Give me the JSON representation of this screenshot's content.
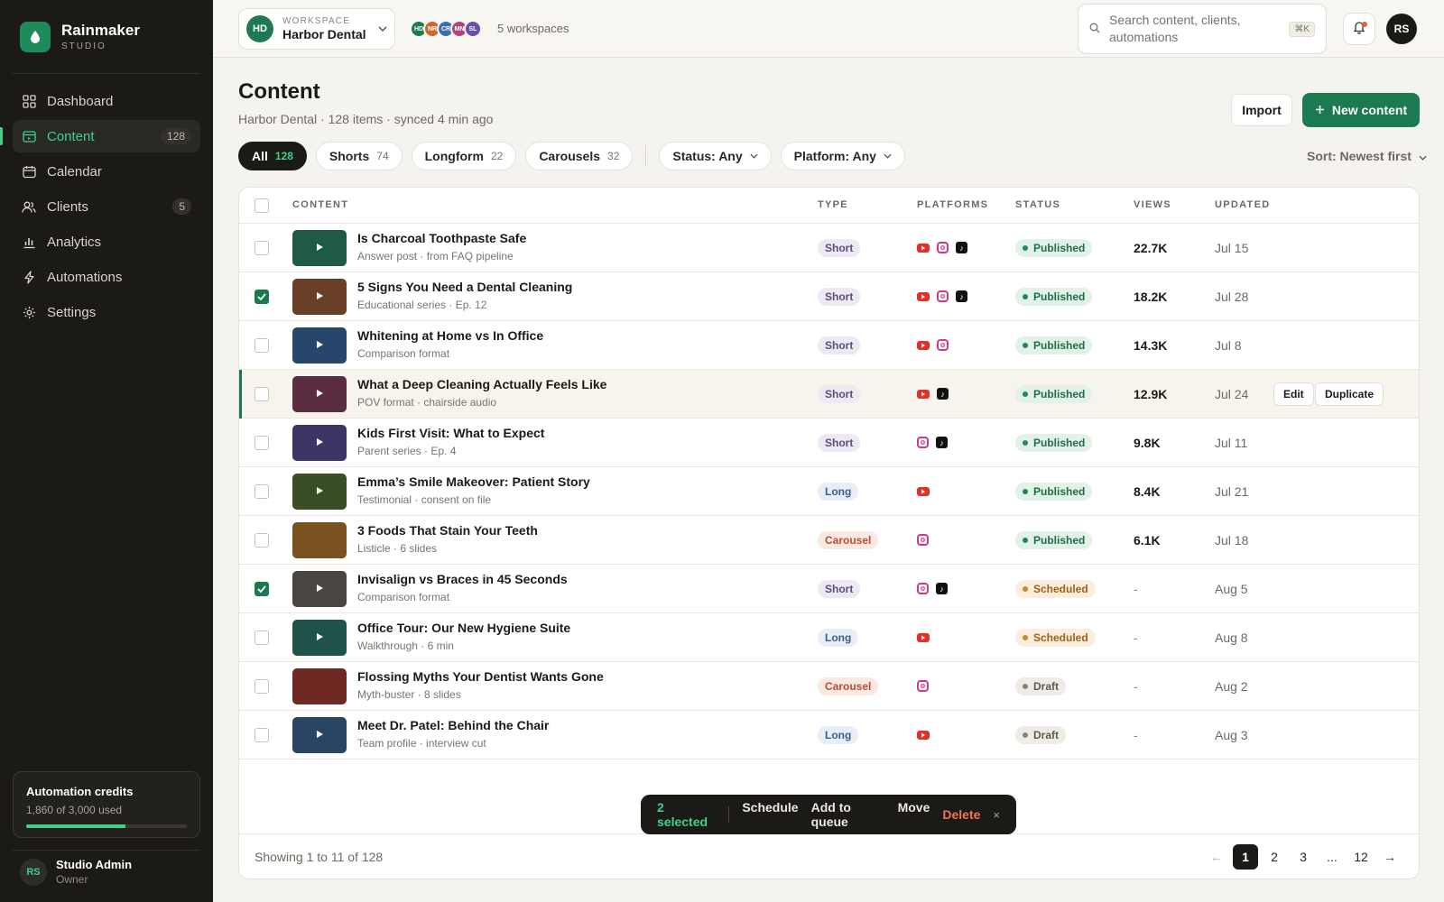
{
  "brand": {
    "name": "Rainmaker",
    "sub": "STUDIO"
  },
  "nav": [
    {
      "label": "Dashboard",
      "icon": "grid-icon",
      "count": ""
    },
    {
      "label": "Content",
      "icon": "content-icon",
      "count": "128",
      "active": true
    },
    {
      "label": "Calendar",
      "icon": "calendar-icon",
      "count": ""
    },
    {
      "label": "Clients",
      "icon": "users-icon",
      "count": "5"
    },
    {
      "label": "Analytics",
      "icon": "bar-chart-icon",
      "count": ""
    },
    {
      "label": "Automations",
      "icon": "bolt-icon",
      "count": ""
    },
    {
      "label": "Settings",
      "icon": "gear-icon",
      "count": ""
    }
  ],
  "credits": {
    "title": "Automation credits",
    "sub": "1,860 of 3,000 used",
    "used_fraction": 0.62
  },
  "user": {
    "initials": "RS",
    "name": "Studio Admin",
    "role": "Owner"
  },
  "workspace": {
    "label": "WORKSPACE",
    "name": "Harbor Dental",
    "initials": "HD",
    "others": [
      {
        "initials": "HD",
        "color": "#1f7a52"
      },
      {
        "initials": "NR",
        "color": "#c46a2d"
      },
      {
        "initials": "CR",
        "color": "#3b6fb0"
      },
      {
        "initials": "MN",
        "color": "#b0457a"
      },
      {
        "initials": "SL",
        "color": "#6a4fa3"
      }
    ],
    "count_label": "5 workspaces"
  },
  "search": {
    "placeholder": "Search content, clients, automations",
    "shortcut": "⌘K"
  },
  "top_avatar": "RS",
  "header": {
    "title": "Content",
    "subtitle": "Harbor Dental · 128 items · synced 4 min ago",
    "import_label": "Import",
    "new_label": "New content"
  },
  "filters": {
    "tabs": [
      {
        "label": "All",
        "count": "128",
        "active": true
      },
      {
        "label": "Shorts",
        "count": "74"
      },
      {
        "label": "Longform",
        "count": "22"
      },
      {
        "label": "Carousels",
        "count": "32"
      }
    ],
    "status": "Status: Any",
    "platform": "Platform: Any",
    "sort": "Sort: Newest first"
  },
  "table": {
    "columns": {
      "content": "CONTENT",
      "type": "TYPE",
      "platforms": "PLATFORMS",
      "status": "STATUS",
      "views": "VIEWS",
      "updated": "UPDATED"
    },
    "rows": [
      {
        "title": "Is Charcoal Toothpaste Safe",
        "sub": "Answer post · from FAQ pipeline",
        "type": "Short",
        "platforms": [
          "youtube",
          "instagram",
          "tiktok"
        ],
        "status": "Published",
        "views": "22.7K",
        "updated": "Jul 15",
        "checked": false,
        "thumb": "#1f5a45",
        "play": true
      },
      {
        "title": "5 Signs You Need a Dental Cleaning",
        "sub": "Educational series · Ep. 12",
        "type": "Short",
        "platforms": [
          "youtube",
          "instagram",
          "tiktok"
        ],
        "status": "Published",
        "views": "18.2K",
        "updated": "Jul 28",
        "checked": true,
        "thumb": "#6a3f28",
        "play": true
      },
      {
        "title": "Whitening at Home vs In Office",
        "sub": "Comparison format",
        "type": "Short",
        "platforms": [
          "youtube",
          "instagram"
        ],
        "status": "Published",
        "views": "14.3K",
        "updated": "Jul 8",
        "checked": false,
        "thumb": "#26476b",
        "play": true
      },
      {
        "title": "What a Deep Cleaning Actually Feels Like",
        "sub": "POV format · chairside audio",
        "type": "Short",
        "platforms": [
          "youtube",
          "tiktok"
        ],
        "status": "Published",
        "views": "12.9K",
        "updated": "Jul 24",
        "checked": false,
        "thumb": "#5a2e40",
        "play": true,
        "hover": true,
        "actions": [
          "Edit",
          "Duplicate"
        ]
      },
      {
        "title": "Kids First Visit: What to Expect",
        "sub": "Parent series · Ep. 4",
        "type": "Short",
        "platforms": [
          "instagram",
          "tiktok"
        ],
        "status": "Published",
        "views": "9.8K",
        "updated": "Jul 11",
        "checked": false,
        "thumb": "#3e3564",
        "play": true
      },
      {
        "title": "Emma’s Smile Makeover: Patient Story",
        "sub": "Testimonial · consent on file",
        "type": "Long",
        "platforms": [
          "youtube"
        ],
        "status": "Published",
        "views": "8.4K",
        "updated": "Jul 21",
        "checked": false,
        "thumb": "#3a4d24",
        "play": true
      },
      {
        "title": "3 Foods That Stain Your Teeth",
        "sub": "Listicle · 6 slides",
        "type": "Carousel",
        "platforms": [
          "instagram"
        ],
        "status": "Published",
        "views": "6.1K",
        "updated": "Jul 18",
        "checked": false,
        "thumb": "#7a5220",
        "play": false
      },
      {
        "title": "Invisalign vs Braces in 45 Seconds",
        "sub": "Comparison format",
        "type": "Short",
        "platforms": [
          "instagram",
          "tiktok"
        ],
        "status": "Scheduled",
        "views": "-",
        "updated": "Aug 5",
        "checked": true,
        "thumb": "#4a4540",
        "play": true
      },
      {
        "title": "Office Tour: Our New Hygiene Suite",
        "sub": "Walkthrough · 6 min",
        "type": "Long",
        "platforms": [
          "youtube"
        ],
        "status": "Scheduled",
        "views": "-",
        "updated": "Aug 8",
        "checked": false,
        "thumb": "#1f5248",
        "play": true
      },
      {
        "title": "Flossing Myths Your Dentist Wants Gone",
        "sub": "Myth-buster · 8 slides",
        "type": "Carousel",
        "platforms": [
          "instagram"
        ],
        "status": "Draft",
        "views": "-",
        "updated": "Aug 2",
        "checked": false,
        "thumb": "#6e2a22",
        "play": false
      },
      {
        "title": "Meet Dr. Patel: Behind the Chair",
        "sub": "Team profile · interview cut",
        "type": "Long",
        "platforms": [
          "youtube"
        ],
        "status": "Draft",
        "views": "-",
        "updated": "Aug 3",
        "checked": false,
        "thumb": "#2a4563",
        "play": true
      }
    ]
  },
  "footer": {
    "showing": "Showing 1 to 11 of 128",
    "pages": [
      "1",
      "2",
      "3",
      "...",
      "12"
    ],
    "current": "1",
    "prev": "←",
    "next": "→"
  },
  "bulk": {
    "selected": "2 selected",
    "actions": [
      "Schedule",
      "Add to queue",
      "Move"
    ],
    "delete": "Delete",
    "close": "×"
  },
  "colors": {
    "accent": "#1c7a51",
    "sidebar": "#1c1a17",
    "active_nav": "#3fd08a"
  }
}
